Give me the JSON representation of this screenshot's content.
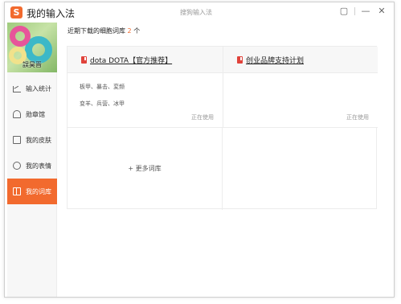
{
  "window": {
    "logo_glyph": "S",
    "app_title": "我的输入法",
    "center_title": "搜狗输入法",
    "controls": {
      "feedback": "▢",
      "minimize": "—",
      "close": "✕"
    }
  },
  "sidebar": {
    "username": "誤昊晋",
    "items": [
      {
        "label": "输入统计",
        "icon": "chart-icon"
      },
      {
        "label": "勋章馆",
        "icon": "bell-icon"
      },
      {
        "label": "我的皮肤",
        "icon": "shirt-icon"
      },
      {
        "label": "我的表情",
        "icon": "smile-icon"
      },
      {
        "label": "我的词库",
        "icon": "book-icon",
        "active": true
      }
    ]
  },
  "main": {
    "section_title": "近期下载的细胞词库",
    "count": "2",
    "count_suffix": "个",
    "cards": [
      {
        "title": "dota DOTA【官方推荐】",
        "lines": [
          "板甲、暴击、変频",
          "变羊、兵营、冰甲"
        ],
        "status": "正在使用"
      },
      {
        "title": "创业品牌支持计划",
        "lines": [],
        "status": "正在使用"
      }
    ],
    "more_label": "+ 更多词库"
  },
  "colors": {
    "accent": "#f26a2e",
    "dict_icon": "#e0433b"
  }
}
